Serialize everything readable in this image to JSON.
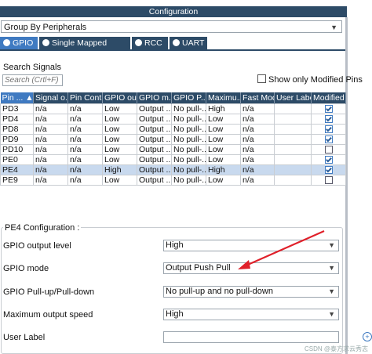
{
  "window_title": "Configuration",
  "group_by": "Group By Peripherals",
  "tabs": [
    {
      "label": "GPIO"
    },
    {
      "label": "Single Mapped Signals"
    },
    {
      "label": "RCC"
    },
    {
      "label": "UART"
    }
  ],
  "search": {
    "label": "Search Signals",
    "placeholder": "Search (Crtl+F)"
  },
  "show_modified": {
    "label": "Show only Modified Pins",
    "checked": false
  },
  "table": {
    "headers": [
      "Pin ...",
      "Signal o...",
      "Pin Cont...",
      "GPIO ou...",
      "GPIO m...",
      "GPIO P...",
      "Maximu...",
      "Fast Mode",
      "User Label",
      "Modified"
    ],
    "rows": [
      {
        "pin": "PD3",
        "signal": "n/a",
        "ctx": "n/a",
        "out": "Low",
        "mode": "Output ...",
        "pull": "No pull-...",
        "max": "High",
        "fast": "n/a",
        "label": "",
        "modified": true
      },
      {
        "pin": "PD4",
        "signal": "n/a",
        "ctx": "n/a",
        "out": "Low",
        "mode": "Output ...",
        "pull": "No pull-...",
        "max": "Low",
        "fast": "n/a",
        "label": "",
        "modified": true
      },
      {
        "pin": "PD8",
        "signal": "n/a",
        "ctx": "n/a",
        "out": "Low",
        "mode": "Output ...",
        "pull": "No pull-...",
        "max": "Low",
        "fast": "n/a",
        "label": "",
        "modified": true
      },
      {
        "pin": "PD9",
        "signal": "n/a",
        "ctx": "n/a",
        "out": "Low",
        "mode": "Output ...",
        "pull": "No pull-...",
        "max": "Low",
        "fast": "n/a",
        "label": "",
        "modified": true
      },
      {
        "pin": "PD10",
        "signal": "n/a",
        "ctx": "n/a",
        "out": "Low",
        "mode": "Output ...",
        "pull": "No pull-...",
        "max": "Low",
        "fast": "n/a",
        "label": "",
        "modified": false
      },
      {
        "pin": "PE0",
        "signal": "n/a",
        "ctx": "n/a",
        "out": "Low",
        "mode": "Output ...",
        "pull": "No pull-...",
        "max": "Low",
        "fast": "n/a",
        "label": "",
        "modified": true
      },
      {
        "pin": "PE4",
        "signal": "n/a",
        "ctx": "n/a",
        "out": "High",
        "mode": "Output ...",
        "pull": "No pull-...",
        "max": "High",
        "fast": "n/a",
        "label": "",
        "modified": true
      },
      {
        "pin": "PE9",
        "signal": "n/a",
        "ctx": "n/a",
        "out": "Low",
        "mode": "Output ...",
        "pull": "No pull-...",
        "max": "Low",
        "fast": "n/a",
        "label": "",
        "modified": false
      }
    ]
  },
  "config": {
    "title": "PE4 Configuration :",
    "fields": [
      {
        "label": "GPIO output level",
        "value": "High"
      },
      {
        "label": "GPIO mode",
        "value": "Output Push Pull"
      },
      {
        "label": "GPIO Pull-up/Pull-down",
        "value": "No pull-up and no pull-down"
      },
      {
        "label": "Maximum output speed",
        "value": "High"
      },
      {
        "label": "User Label",
        "value": ""
      }
    ]
  },
  "annotation_arrow_color": "#e0202a",
  "watermark": "CSDN @泰方求云秀志"
}
